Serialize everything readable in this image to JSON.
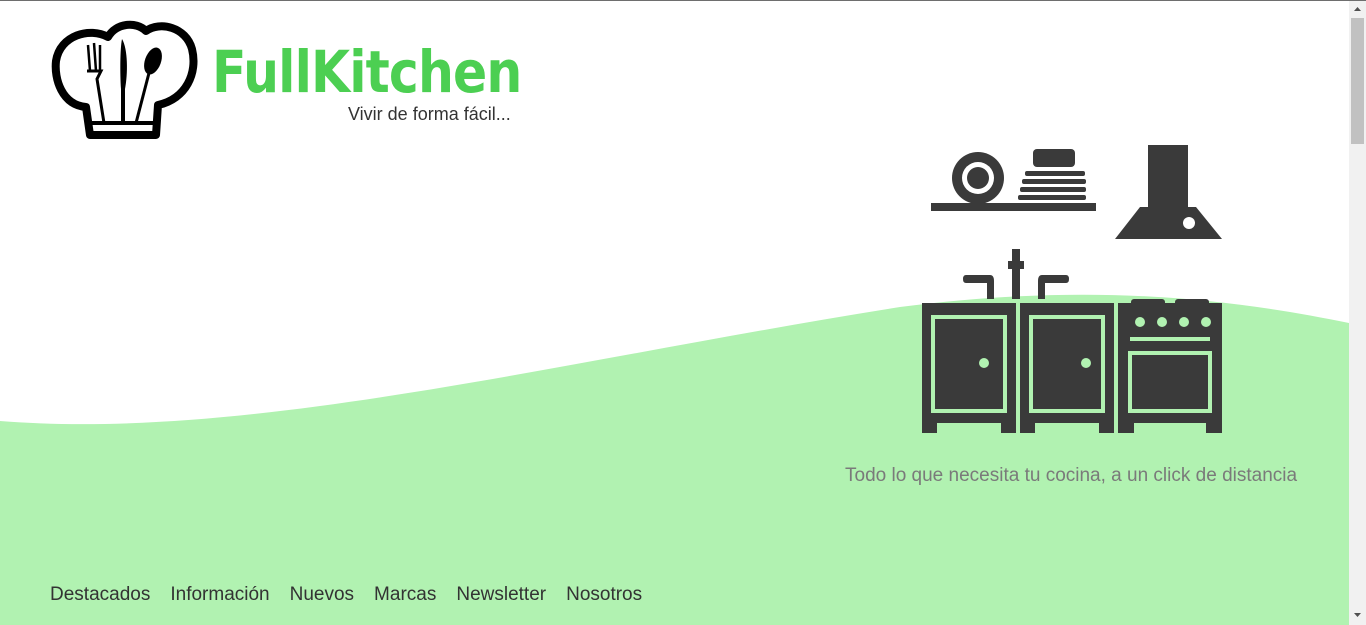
{
  "brand": {
    "name": "FullKitchen",
    "tagline": "Vivir de forma fácil...",
    "color": "#4ccf52"
  },
  "hero": {
    "subtitle": "Todo lo que necesita tu cocina, a un click de distancia",
    "wave_color": "#b1f2b1",
    "illustration_color": "#3a3a3a"
  },
  "nav": {
    "items": [
      {
        "label": "Destacados"
      },
      {
        "label": "Información"
      },
      {
        "label": "Nuevos"
      },
      {
        "label": "Marcas"
      },
      {
        "label": "Newsletter"
      },
      {
        "label": "Nosotros"
      }
    ]
  },
  "icons": {
    "logo": "chef-hat-icon",
    "illustration": "kitchen-furniture-icon",
    "scroll_up": "triangle-up-icon",
    "scroll_down": "triangle-down-icon"
  }
}
